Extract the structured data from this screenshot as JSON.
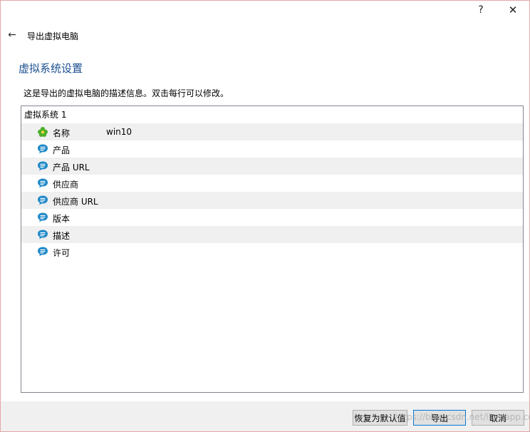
{
  "window": {
    "help_label": "?",
    "close_label": "✕"
  },
  "header": {
    "back_icon": "←",
    "title": "导出虚拟电脑"
  },
  "section": {
    "title": "虚拟系统设置",
    "description": "这是导出的虚拟电脑的描述信息。双击每行可以修改。"
  },
  "tree": {
    "root_label": "虚拟系统 1",
    "rows": [
      {
        "label": "名称",
        "value": "win10",
        "icon": "name-icon"
      },
      {
        "label": "产品",
        "value": "",
        "icon": "comment-icon"
      },
      {
        "label": "产品 URL",
        "value": "",
        "icon": "comment-icon"
      },
      {
        "label": "供应商",
        "value": "",
        "icon": "comment-icon"
      },
      {
        "label": "供应商 URL",
        "value": "",
        "icon": "comment-icon"
      },
      {
        "label": "版本",
        "value": "",
        "icon": "comment-icon"
      },
      {
        "label": "描述",
        "value": "",
        "icon": "comment-icon"
      },
      {
        "label": "许可",
        "value": "",
        "icon": "comment-icon"
      }
    ]
  },
  "buttons": {
    "restore_defaults": "恢复为默认值",
    "export": "导出",
    "cancel": "取消"
  },
  "watermark": "https://blog.csdn.net/liumapp.com",
  "colors": {
    "title_blue": "#1b4f8f",
    "icon_blue": "#1e88c8",
    "icon_green": "#4caf2a",
    "alt_row": "#f0f0f0",
    "focus_border": "#0078d7"
  }
}
